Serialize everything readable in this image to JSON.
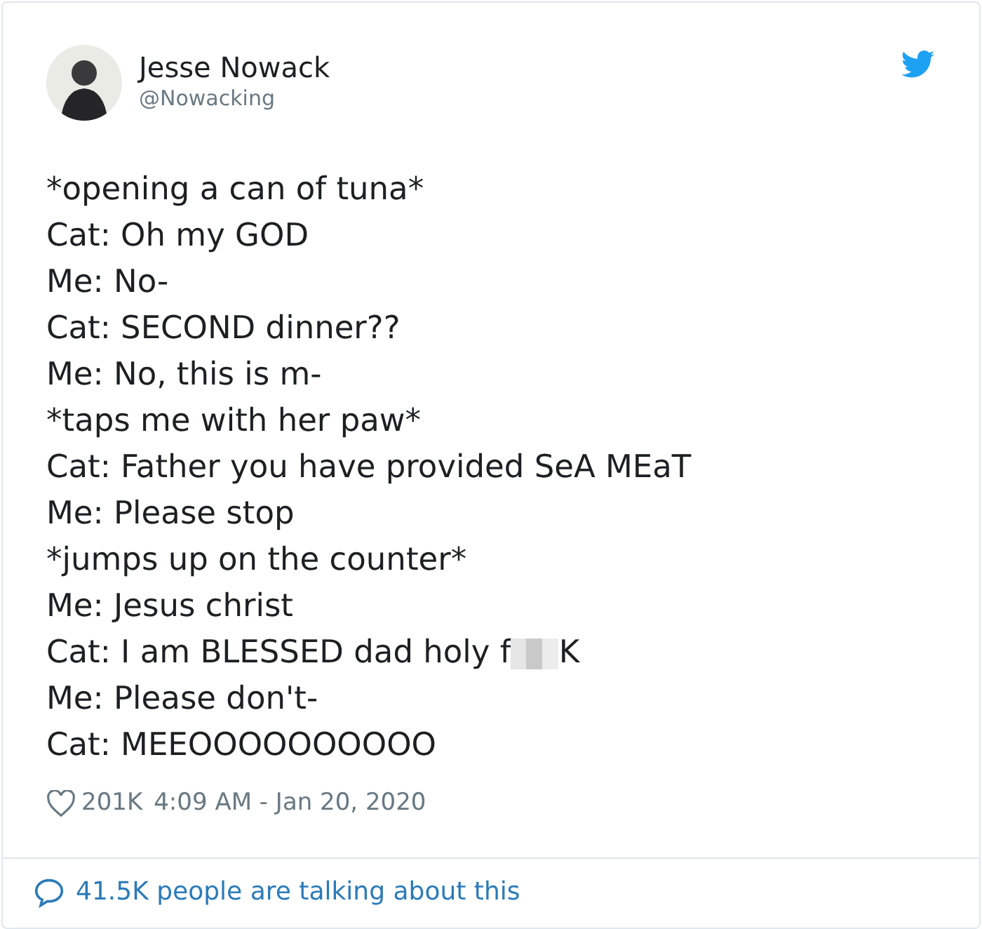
{
  "author": {
    "name": "Jesse Nowack",
    "handle": "@Nowacking"
  },
  "lines": [
    {
      "text": "*opening a can of tuna*"
    },
    {
      "text": "Cat: Oh my GOD"
    },
    {
      "text": "Me: No-"
    },
    {
      "text": "Cat: SECOND dinner??"
    },
    {
      "text": "Me: No, this is m-"
    },
    {
      "text": "*taps me with her paw*"
    },
    {
      "text": "Cat: Father you have provided SeA MEaT"
    },
    {
      "text": "Me: Please stop"
    },
    {
      "text": "*jumps up on the counter*"
    },
    {
      "text": "Me: Jesus christ"
    },
    {
      "text": "Cat: I am BLESSED dad holy f",
      "censored": true,
      "text_after": "K"
    },
    {
      "text": "Me: Please don't-"
    },
    {
      "text": "Cat: MEEOOOOOOOOOO"
    }
  ],
  "likes": "201K",
  "timestamp": "4:09 AM - Jan 20, 2020",
  "conversation": "41.5K people are talking about this"
}
